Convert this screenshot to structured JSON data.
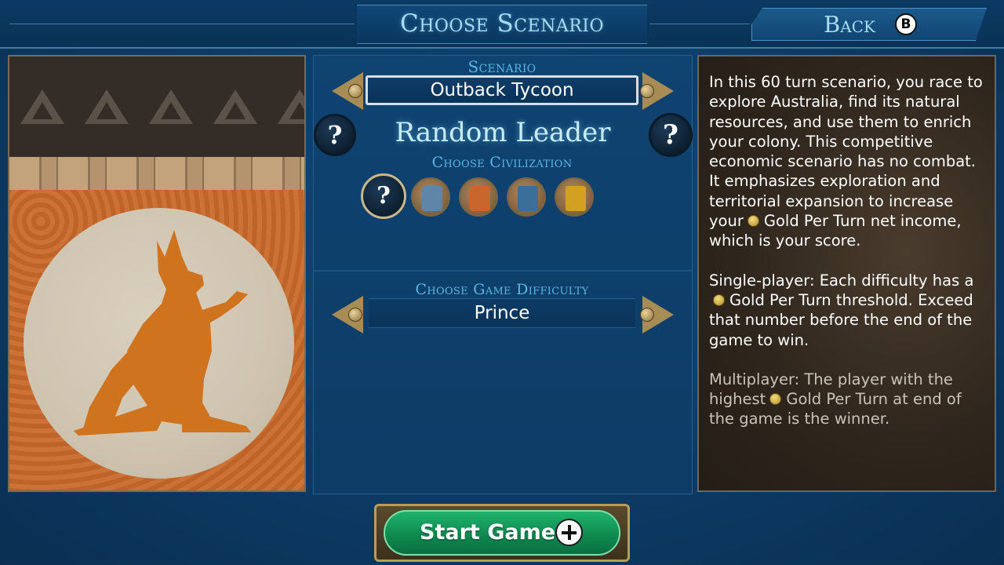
{
  "header": {
    "title": "Choose Scenario",
    "back_label": "Back",
    "back_button_badge": "B"
  },
  "scenario": {
    "section_label": "Scenario",
    "selected": "Outback Tycoon"
  },
  "leader": {
    "name": "Random Leader",
    "left_icon": "?",
    "right_icon": "?",
    "choose_civ_label": "Choose Civilization",
    "civ_options": [
      {
        "icon": "?",
        "kind": "random"
      },
      {
        "icon": "koala-emblem-icon",
        "color": "#5f86a6"
      },
      {
        "icon": "wombat-emblem-icon",
        "color": "#c8662b"
      },
      {
        "icon": "parrot-emblem-icon",
        "color": "#3b6f9a"
      },
      {
        "icon": "kangaroo-emblem-icon",
        "color": "#d4a021"
      }
    ]
  },
  "difficulty": {
    "section_label": "Choose Game Difficulty",
    "selected": "Prince"
  },
  "description": {
    "p1_a": "In this 60 turn scenario, you race to explore Australia, find its natural resources, and use them to enrich your colony. This competitive economic scenario has no combat. It emphasizes exploration and territorial expansion to increase your",
    "p1_b": "Gold Per Turn net income, which is your score.",
    "p2_a": "Single-player: Each difficulty has a",
    "p2_b": "Gold Per Turn threshold. Exceed that number before the end of the game to win.",
    "p3_a": "Multiplayer: The player with the highest",
    "p3_b": "Gold Per Turn at end of the game is the winner."
  },
  "start": {
    "label": "Start Game"
  },
  "colors": {
    "background": "#0e3d69",
    "title_text": "#a8dcf0",
    "section_label": "#5ab6e3",
    "start_green": "#0f8a50",
    "gold_trim": "#b99c5a"
  }
}
